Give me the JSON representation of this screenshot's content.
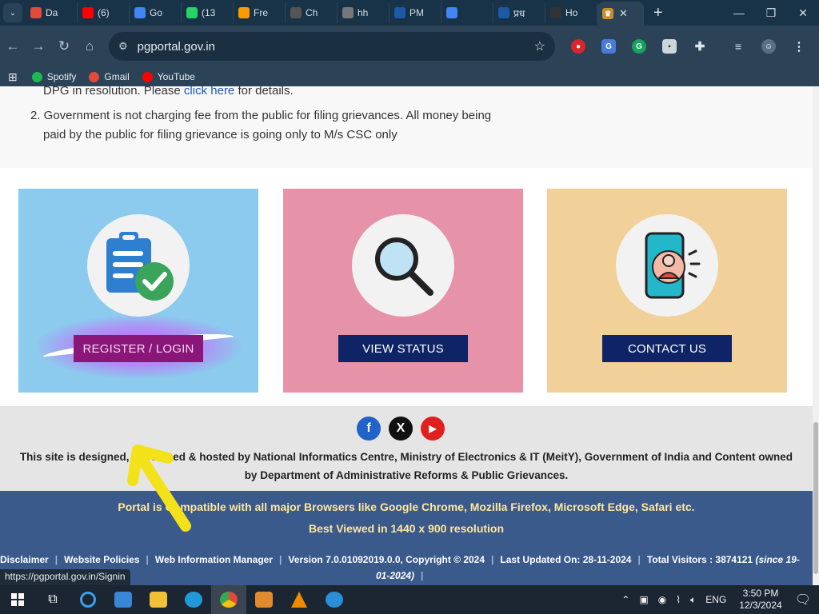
{
  "browser": {
    "tabs": [
      {
        "label": "Da",
        "icon": "gmail-icon",
        "color": "#e24a3b"
      },
      {
        "label": "(6)",
        "icon": "youtube-icon",
        "color": "#ff0000"
      },
      {
        "label": "Go",
        "icon": "docs-icon",
        "color": "#4285f4"
      },
      {
        "label": "(13",
        "icon": "whatsapp-icon",
        "color": "#25d366"
      },
      {
        "label": "Fre",
        "icon": "amazon-icon",
        "color": "#ff9900"
      },
      {
        "label": "Ch",
        "icon": "chatgpt-icon",
        "color": "#555555"
      },
      {
        "label": "hh",
        "icon": "globe-icon",
        "color": "#777777"
      },
      {
        "label": "PM",
        "icon": "pb-icon",
        "color": "#1c5aa6"
      },
      {
        "label": "",
        "icon": "google-icon",
        "color": "#4285f4"
      },
      {
        "label": "प्रध",
        "icon": "pb-icon",
        "color": "#1c5aa6"
      },
      {
        "label": "Ho",
        "icon": "tab-icon",
        "color": "#333333"
      }
    ],
    "active_tab": {
      "icon": "emblem-icon",
      "color": "#c8902b"
    },
    "url": "pgportal.gov.in",
    "bookmarks": [
      {
        "label": "Spotify",
        "color": "#1db954"
      },
      {
        "label": "Gmail",
        "color": "#e24a3b"
      },
      {
        "label": "YouTube",
        "color": "#ff0000"
      }
    ],
    "status_url": "https://pgportal.gov.in/Signin"
  },
  "notice": {
    "line1_prefix": "DPG in resolution. Please ",
    "line1_link": "click here",
    "line1_suffix": " for details.",
    "line2": "2. Government is not charging fee from the public for filing grievances. All money being",
    "line3": "paid by the public for filing grievance is going only to M/s CSC only"
  },
  "cards": {
    "register_label": "REGISTER / LOGIN",
    "status_label": "VIEW STATUS",
    "contact_label": "CONTACT US"
  },
  "social": {
    "facebook": "f",
    "x": "X",
    "youtube": "▶"
  },
  "credit": {
    "line1": "This site is designed, developed & hosted by National Informatics Centre, Ministry of Electronics & IT (MeitY), Government of India and Content owned",
    "line2": "by Department of Administrative Reforms & Public Grievances."
  },
  "footer": {
    "compat": "Portal is Compatible with all major Browsers like Google Chrome, Mozilla Firefox, Microsoft Edge, Safari etc.",
    "best_viewed": "Best Viewed in 1440 x 900 resolution",
    "links": {
      "disclaimer": "Disclaimer",
      "policies": "Website Policies",
      "wim": "Web Information Manager",
      "version": "Version 7.0.01092019.0.0, Copyright © 2024",
      "updated": "Last Updated On: 28-11-2024",
      "visitors": "Total Visitors : 3874121",
      "since_a": "(since 19-",
      "since_b": "01-2024)"
    }
  },
  "taskbar": {
    "lang": "ENG",
    "time": "3:50 PM",
    "date": "12/3/2024"
  }
}
